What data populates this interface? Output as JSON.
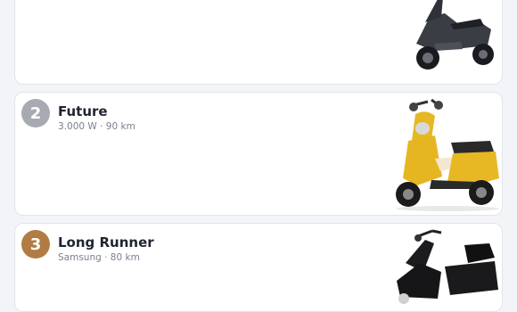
{
  "colors": {
    "page_bg": "#f3f4f8",
    "card_bg": "#ffffff",
    "rank_silver": "#a7aab1",
    "rank_bronze": "#b07c43"
  },
  "cards": [
    {
      "image": "dark-grey-scooter"
    },
    {
      "rank": "2",
      "title": "Future",
      "subtitle": "3.000 W · 90 km",
      "image": "yellow-scooter"
    },
    {
      "rank": "3",
      "title": "Long Runner",
      "subtitle": "Samsung · 80 km",
      "image": "black-scooter-with-top-box"
    }
  ]
}
